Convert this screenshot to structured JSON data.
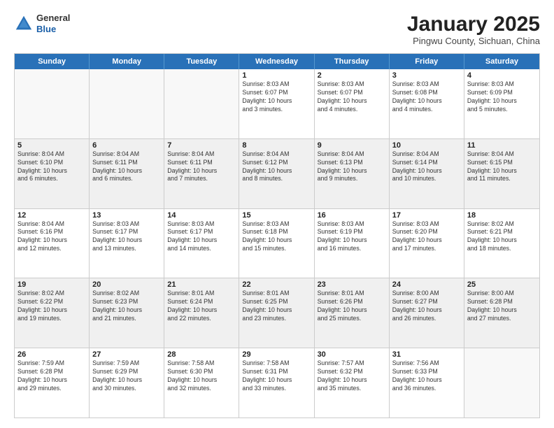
{
  "header": {
    "logo_general": "General",
    "logo_blue": "Blue",
    "month_title": "January 2025",
    "subtitle": "Pingwu County, Sichuan, China"
  },
  "weekdays": [
    "Sunday",
    "Monday",
    "Tuesday",
    "Wednesday",
    "Thursday",
    "Friday",
    "Saturday"
  ],
  "rows": [
    [
      {
        "day": "",
        "empty": true
      },
      {
        "day": "",
        "empty": true
      },
      {
        "day": "",
        "empty": true
      },
      {
        "day": "1",
        "info": "Sunrise: 8:03 AM\nSunset: 6:07 PM\nDaylight: 10 hours\nand 3 minutes."
      },
      {
        "day": "2",
        "info": "Sunrise: 8:03 AM\nSunset: 6:07 PM\nDaylight: 10 hours\nand 4 minutes."
      },
      {
        "day": "3",
        "info": "Sunrise: 8:03 AM\nSunset: 6:08 PM\nDaylight: 10 hours\nand 4 minutes."
      },
      {
        "day": "4",
        "info": "Sunrise: 8:03 AM\nSunset: 6:09 PM\nDaylight: 10 hours\nand 5 minutes."
      }
    ],
    [
      {
        "day": "5",
        "info": "Sunrise: 8:04 AM\nSunset: 6:10 PM\nDaylight: 10 hours\nand 6 minutes."
      },
      {
        "day": "6",
        "info": "Sunrise: 8:04 AM\nSunset: 6:11 PM\nDaylight: 10 hours\nand 6 minutes."
      },
      {
        "day": "7",
        "info": "Sunrise: 8:04 AM\nSunset: 6:11 PM\nDaylight: 10 hours\nand 7 minutes."
      },
      {
        "day": "8",
        "info": "Sunrise: 8:04 AM\nSunset: 6:12 PM\nDaylight: 10 hours\nand 8 minutes."
      },
      {
        "day": "9",
        "info": "Sunrise: 8:04 AM\nSunset: 6:13 PM\nDaylight: 10 hours\nand 9 minutes."
      },
      {
        "day": "10",
        "info": "Sunrise: 8:04 AM\nSunset: 6:14 PM\nDaylight: 10 hours\nand 10 minutes."
      },
      {
        "day": "11",
        "info": "Sunrise: 8:04 AM\nSunset: 6:15 PM\nDaylight: 10 hours\nand 11 minutes."
      }
    ],
    [
      {
        "day": "12",
        "info": "Sunrise: 8:04 AM\nSunset: 6:16 PM\nDaylight: 10 hours\nand 12 minutes."
      },
      {
        "day": "13",
        "info": "Sunrise: 8:03 AM\nSunset: 6:17 PM\nDaylight: 10 hours\nand 13 minutes."
      },
      {
        "day": "14",
        "info": "Sunrise: 8:03 AM\nSunset: 6:17 PM\nDaylight: 10 hours\nand 14 minutes."
      },
      {
        "day": "15",
        "info": "Sunrise: 8:03 AM\nSunset: 6:18 PM\nDaylight: 10 hours\nand 15 minutes."
      },
      {
        "day": "16",
        "info": "Sunrise: 8:03 AM\nSunset: 6:19 PM\nDaylight: 10 hours\nand 16 minutes."
      },
      {
        "day": "17",
        "info": "Sunrise: 8:03 AM\nSunset: 6:20 PM\nDaylight: 10 hours\nand 17 minutes."
      },
      {
        "day": "18",
        "info": "Sunrise: 8:02 AM\nSunset: 6:21 PM\nDaylight: 10 hours\nand 18 minutes."
      }
    ],
    [
      {
        "day": "19",
        "info": "Sunrise: 8:02 AM\nSunset: 6:22 PM\nDaylight: 10 hours\nand 19 minutes."
      },
      {
        "day": "20",
        "info": "Sunrise: 8:02 AM\nSunset: 6:23 PM\nDaylight: 10 hours\nand 21 minutes."
      },
      {
        "day": "21",
        "info": "Sunrise: 8:01 AM\nSunset: 6:24 PM\nDaylight: 10 hours\nand 22 minutes."
      },
      {
        "day": "22",
        "info": "Sunrise: 8:01 AM\nSunset: 6:25 PM\nDaylight: 10 hours\nand 23 minutes."
      },
      {
        "day": "23",
        "info": "Sunrise: 8:01 AM\nSunset: 6:26 PM\nDaylight: 10 hours\nand 25 minutes."
      },
      {
        "day": "24",
        "info": "Sunrise: 8:00 AM\nSunset: 6:27 PM\nDaylight: 10 hours\nand 26 minutes."
      },
      {
        "day": "25",
        "info": "Sunrise: 8:00 AM\nSunset: 6:28 PM\nDaylight: 10 hours\nand 27 minutes."
      }
    ],
    [
      {
        "day": "26",
        "info": "Sunrise: 7:59 AM\nSunset: 6:28 PM\nDaylight: 10 hours\nand 29 minutes."
      },
      {
        "day": "27",
        "info": "Sunrise: 7:59 AM\nSunset: 6:29 PM\nDaylight: 10 hours\nand 30 minutes."
      },
      {
        "day": "28",
        "info": "Sunrise: 7:58 AM\nSunset: 6:30 PM\nDaylight: 10 hours\nand 32 minutes."
      },
      {
        "day": "29",
        "info": "Sunrise: 7:58 AM\nSunset: 6:31 PM\nDaylight: 10 hours\nand 33 minutes."
      },
      {
        "day": "30",
        "info": "Sunrise: 7:57 AM\nSunset: 6:32 PM\nDaylight: 10 hours\nand 35 minutes."
      },
      {
        "day": "31",
        "info": "Sunrise: 7:56 AM\nSunset: 6:33 PM\nDaylight: 10 hours\nand 36 minutes."
      },
      {
        "day": "",
        "empty": true
      }
    ]
  ]
}
